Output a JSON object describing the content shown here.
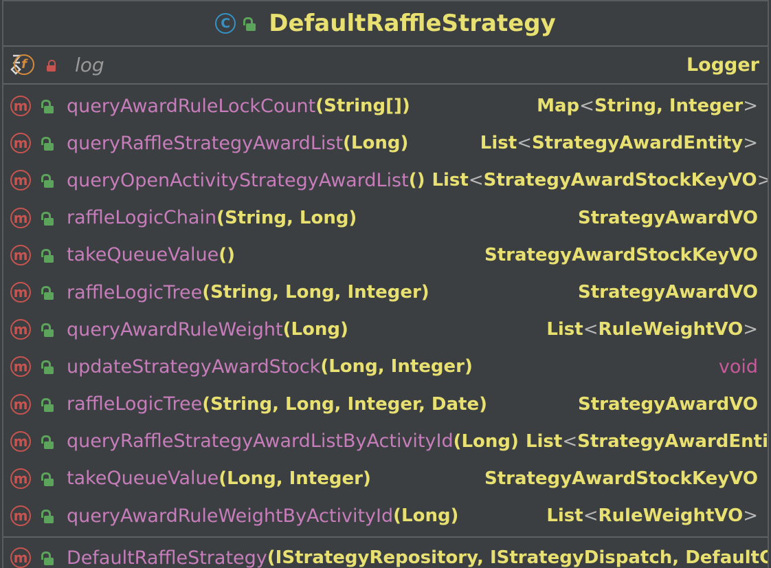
{
  "class": {
    "badge": "C",
    "name": "DefaultRaffleStrategy"
  },
  "field": {
    "badge": "f",
    "name": "log",
    "type": "Logger"
  },
  "methods": [
    {
      "name": "queryAwardRuleLockCount",
      "params": "(String[])",
      "ret_main": "Map",
      "ret_inner": "String, Integer"
    },
    {
      "name": "queryRaffleStrategyAwardList",
      "params": "(Long)",
      "ret_main": "List",
      "ret_inner": "StrategyAwardEntity"
    },
    {
      "name": "queryOpenActivityStrategyAwardList",
      "params": "()",
      "ret_main": "List",
      "ret_inner": "StrategyAwardStockKeyVO"
    },
    {
      "name": "raffleLogicChain",
      "params": "(String, Long)",
      "ret": "StrategyAwardVO"
    },
    {
      "name": "takeQueueValue",
      "params": "()",
      "ret": "StrategyAwardStockKeyVO"
    },
    {
      "name": "raffleLogicTree",
      "params": "(String, Long, Integer)",
      "ret": "StrategyAwardVO"
    },
    {
      "name": "queryAwardRuleWeight",
      "params": "(Long)",
      "ret_main": "List",
      "ret_inner": "RuleWeightVO"
    },
    {
      "name": "updateStrategyAwardStock",
      "params": "(Long, Integer)",
      "ret_void": "void"
    },
    {
      "name": "raffleLogicTree",
      "params": "(String, Long, Integer, Date)",
      "ret": "StrategyAwardVO"
    },
    {
      "name": "queryRaffleStrategyAwardListByActivityId",
      "params": "(Long)",
      "ret_main": "List",
      "ret_inner": "StrategyAwardEntity"
    },
    {
      "name": "takeQueueValue",
      "params": "(Long, Integer)",
      "ret": "StrategyAwardStockKeyVO"
    },
    {
      "name": "queryAwardRuleWeightByActivityId",
      "params": "(Long)",
      "ret_main": "List",
      "ret_inner": "RuleWeightVO"
    }
  ],
  "constructor": {
    "name": "DefaultRaffleStrategy",
    "params": "(IStrategyRepository, IStrategyDispatch, DefaultChainF"
  },
  "icons": {
    "method_badge": "m",
    "angle_open": "<",
    "angle_close": ">"
  },
  "colors": {
    "background": "#3c3f41",
    "type": "#e8e070",
    "method": "#c77dbb",
    "void": "#c75a9a",
    "public_lock": "#5ca35c",
    "private_lock": "#c75450",
    "class_icon": "#3592c4"
  }
}
